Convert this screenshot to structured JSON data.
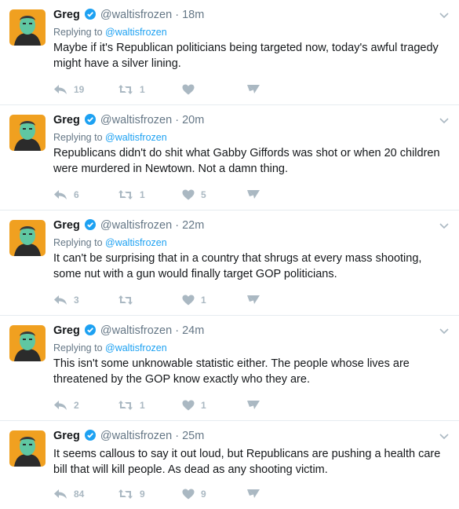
{
  "tweets": [
    {
      "name": "Greg",
      "handle": "@waltisfrozen",
      "separator": "·",
      "time": "18m",
      "replying_prefix": "Replying to ",
      "replying_to": "@waltisfrozen",
      "text": "Maybe if it's Republican politicians being targeted now, today's awful tragedy might have a silver lining.",
      "replies": "19",
      "retweets": "1",
      "likes": ""
    },
    {
      "name": "Greg",
      "handle": "@waltisfrozen",
      "separator": "·",
      "time": "20m",
      "replying_prefix": "Replying to ",
      "replying_to": "@waltisfrozen",
      "text": "Republicans didn't do shit what Gabby Giffords was shot or when 20 children were murdered in Newtown. Not a damn thing.",
      "replies": "6",
      "retweets": "1",
      "likes": "5"
    },
    {
      "name": "Greg",
      "handle": "@waltisfrozen",
      "separator": "·",
      "time": "22m",
      "replying_prefix": "Replying to ",
      "replying_to": "@waltisfrozen",
      "text": "It can't be surprising that in a country that shrugs at every mass shooting, some nut with a gun would finally target GOP politicians.",
      "replies": "3",
      "retweets": "",
      "likes": "1"
    },
    {
      "name": "Greg",
      "handle": "@waltisfrozen",
      "separator": "·",
      "time": "24m",
      "replying_prefix": "Replying to ",
      "replying_to": "@waltisfrozen",
      "text": "This isn't some unknowable statistic either. The people whose lives are threatened by the GOP know exactly who they are.",
      "replies": "2",
      "retweets": "1",
      "likes": "1"
    },
    {
      "name": "Greg",
      "handle": "@waltisfrozen",
      "separator": "·",
      "time": "25m",
      "text": "It seems callous to say it out loud, but Republicans are pushing a health care bill that will kill people. As dead as any shooting victim.",
      "replies": "84",
      "retweets": "9",
      "likes": "9"
    }
  ],
  "icons": {
    "reply": "reply-icon",
    "retweet": "retweet-icon",
    "like": "heart-icon",
    "dm": "envelope-icon",
    "verified": "verified-badge-icon",
    "caret": "chevron-down-icon"
  },
  "colors": {
    "link": "#1da1f2",
    "muted": "#657786",
    "action": "#aab8c2",
    "avatar_bg": "#f0a020",
    "avatar_face": "#5fc7a2"
  }
}
